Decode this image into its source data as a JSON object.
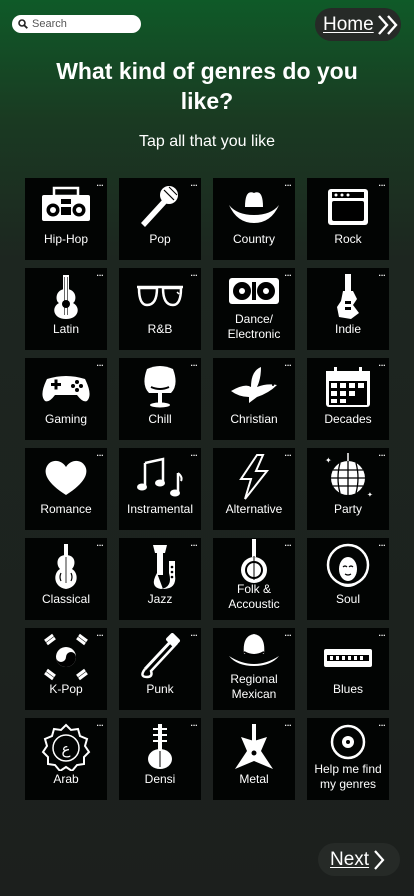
{
  "header": {
    "search_placeholder": "Search",
    "home_label": "Home"
  },
  "title": "What kind of genres do you like?",
  "subtitle": "Tap all that you like",
  "more_glyph": "...",
  "genres": [
    {
      "label": "Hip-Hop",
      "icon": "boombox-icon"
    },
    {
      "label": "Pop",
      "icon": "microphone-icon"
    },
    {
      "label": "Country",
      "icon": "cowboy-hat-icon"
    },
    {
      "label": "Rock",
      "icon": "amplifier-icon"
    },
    {
      "label": "Latin",
      "icon": "guitar-icon"
    },
    {
      "label": "R&B",
      "icon": "sunglasses-icon"
    },
    {
      "label": "Dance/ Electronic",
      "icon": "turntable-icon"
    },
    {
      "label": "Indie",
      "icon": "electric-guitar-icon"
    },
    {
      "label": "Gaming",
      "icon": "gamepad-icon"
    },
    {
      "label": "Chill",
      "icon": "egg-chair-icon"
    },
    {
      "label": "Christian",
      "icon": "dove-icon"
    },
    {
      "label": "Decades",
      "icon": "calendar-icon"
    },
    {
      "label": "Romance",
      "icon": "heart-icon"
    },
    {
      "label": "Instramental",
      "icon": "music-notes-icon"
    },
    {
      "label": "Alternative",
      "icon": "lightning-icon"
    },
    {
      "label": "Party",
      "icon": "disco-ball-icon"
    },
    {
      "label": "Classical",
      "icon": "violin-icon"
    },
    {
      "label": "Jazz",
      "icon": "saxophone-icon"
    },
    {
      "label": "Folk & Accoustic",
      "icon": "banjo-icon"
    },
    {
      "label": "Soul",
      "icon": "afro-face-icon"
    },
    {
      "label": "K-Pop",
      "icon": "korean-flag-icon"
    },
    {
      "label": "Punk",
      "icon": "safety-pin-icon"
    },
    {
      "label": "Regional Mexican",
      "icon": "sombrero-icon"
    },
    {
      "label": "Blues",
      "icon": "harmonica-icon"
    },
    {
      "label": "Arab",
      "icon": "arabic-emblem-icon"
    },
    {
      "label": "Densi",
      "icon": "sitar-icon"
    },
    {
      "label": "Metal",
      "icon": "metal-guitar-icon"
    },
    {
      "label": "Help me find my genres",
      "icon": "vinyl-record-icon"
    }
  ],
  "footer": {
    "next_label": "Next"
  }
}
